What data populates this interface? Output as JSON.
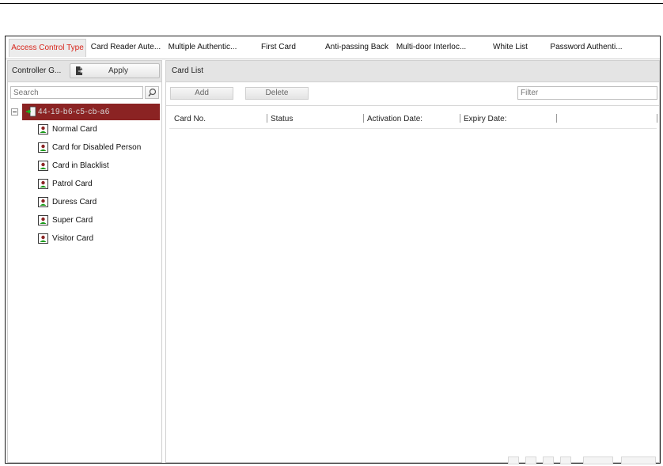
{
  "tabs": [
    {
      "label": "Access Control Type",
      "active": true
    },
    {
      "label": "Card Reader Aute...",
      "active": false
    },
    {
      "label": "Multiple Authentic...",
      "active": false
    },
    {
      "label": "First Card",
      "active": false
    },
    {
      "label": "Anti-passing Back",
      "active": false
    },
    {
      "label": "Multi-door Interloc...",
      "active": false
    },
    {
      "label": "White List",
      "active": false
    },
    {
      "label": "Password Authenti...",
      "active": false
    }
  ],
  "left_panel": {
    "header_label": "Controller G...",
    "apply_label": "Apply",
    "search_placeholder": "Search",
    "tree": {
      "root": "44-19-b6-c5-cb-a6",
      "items": [
        "Normal Card",
        "Card for Disabled Person",
        "Card in Blacklist",
        "Patrol Card",
        "Duress Card",
        "Super Card",
        "Visitor Card"
      ]
    }
  },
  "right_panel": {
    "title": "Card List",
    "add_label": "Add",
    "delete_label": "Delete",
    "filter_placeholder": "Filter",
    "columns": [
      "Card No.",
      "Status",
      "Activation Date:",
      "Expiry Date:"
    ]
  },
  "colors": {
    "active_tab_text": "#d8261c",
    "tree_selected_bg": "#8b2323",
    "panel_header_bg": "#e4e4e4"
  },
  "icons": {
    "apply": "save-apply-icon",
    "search": "magnifier-icon",
    "root": "door-controller-icon",
    "item": "card-person-icon"
  }
}
